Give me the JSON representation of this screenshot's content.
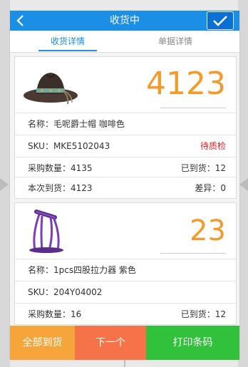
{
  "header": {
    "title": "收货中",
    "back_icon": "chevron-left-icon",
    "confirm_icon": "checkmark-icon"
  },
  "tabs": [
    {
      "label": "收货详情",
      "active": true
    },
    {
      "label": "单据详情",
      "active": false
    }
  ],
  "items": [
    {
      "image_icon": "cowboy-hat-image",
      "received_qty": "4123",
      "name_label": "名称：",
      "name": "毛呢爵士帽 咖啡色",
      "sku_label": "SKU：",
      "sku": "MKE5102043",
      "status": "待质检",
      "purchase_label": "采购数量：",
      "purchase_qty": "4135",
      "arrived_label": "已到货：",
      "arrived_qty": "12",
      "this_label": "本次到货：",
      "this_qty": "4123",
      "diff_label": "差异：",
      "diff_qty": "0"
    },
    {
      "image_icon": "resistance-band-image",
      "received_qty": "23",
      "name_label": "名称：",
      "name": "1pcs四股拉力器 紫色",
      "sku_label": "SKU：",
      "sku": "204Y04002",
      "purchase_label": "采购数量：",
      "purchase_qty": "16",
      "arrived_label": "已到货：",
      "arrived_qty": "12"
    }
  ],
  "footer": {
    "all_arrived": "全部到货",
    "next": "下一个",
    "print_barcode": "打印条码"
  },
  "colors": {
    "primary": "#1b8ee6",
    "qty": "#f39a2a",
    "status": "#e0202a",
    "btn_orange": "#f5a53a",
    "btn_red": "#f6734a",
    "btn_green": "#31c13b"
  }
}
